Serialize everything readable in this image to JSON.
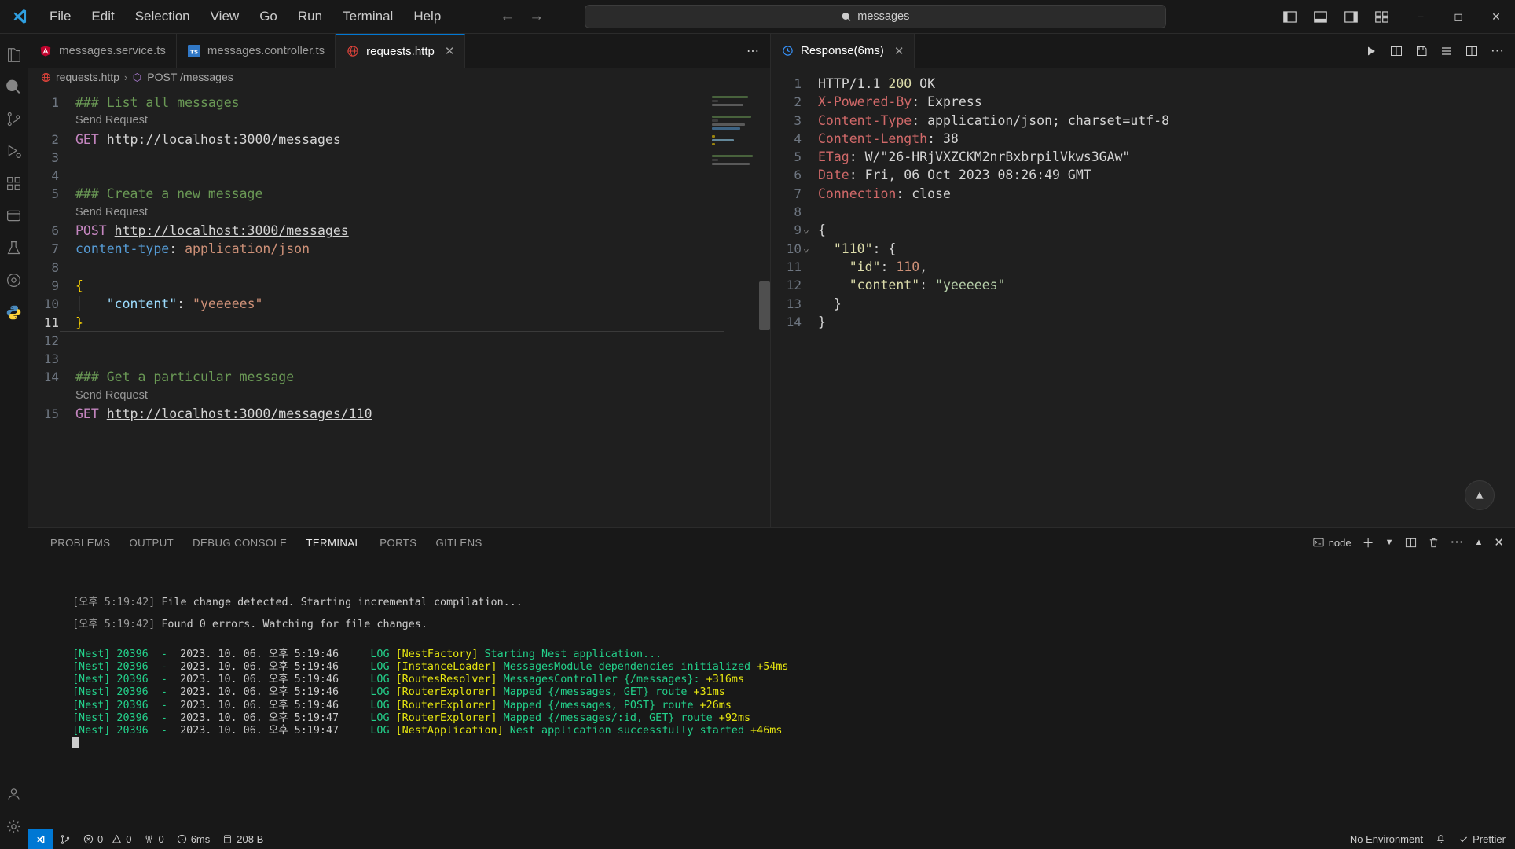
{
  "titlebar": {
    "logo_icon": "vscode-logo-icon",
    "menus": [
      "File",
      "Edit",
      "Selection",
      "View",
      "Go",
      "Run",
      "Terminal",
      "Help"
    ],
    "back_icon": "arrow-left-icon",
    "forward_icon": "arrow-right-icon",
    "command_center": {
      "search_icon": "search-icon",
      "value": "messages"
    },
    "layout_icons": [
      "toggle-primary-sidebar-icon",
      "toggle-panel-icon",
      "toggle-secondary-sidebar-icon",
      "customize-layout-icon"
    ],
    "window_controls": {
      "minimize": "minimize-icon",
      "maximize": "maximize-icon",
      "close": "close-icon"
    }
  },
  "activitybar": {
    "items": [
      {
        "name": "explorer",
        "icon": "files-icon"
      },
      {
        "name": "search",
        "icon": "search-icon"
      },
      {
        "name": "source-control",
        "icon": "source-control-icon"
      },
      {
        "name": "run-and-debug",
        "icon": "run-debug-icon"
      },
      {
        "name": "extensions",
        "icon": "extensions-icon"
      },
      {
        "name": "rest-client",
        "icon": "rest-client-icon"
      },
      {
        "name": "testing",
        "icon": "beaker-icon"
      },
      {
        "name": "gitlens",
        "icon": "gitlens-icon"
      },
      {
        "name": "python",
        "icon": "python-icon"
      }
    ],
    "bottom": [
      {
        "name": "accounts",
        "icon": "account-icon"
      },
      {
        "name": "manage",
        "icon": "gear-icon"
      }
    ]
  },
  "editor_left": {
    "tabs": [
      {
        "label": "messages.service.ts",
        "icon": "angular-file-icon",
        "active": false
      },
      {
        "label": "messages.controller.ts",
        "icon": "typescript-file-icon",
        "active": false
      },
      {
        "label": "requests.http",
        "icon": "http-file-icon",
        "active": true,
        "close_icon": "close-icon"
      }
    ],
    "overflow_icon": "more-actions-icon",
    "breadcrumb": [
      {
        "label": "requests.http",
        "icon": "http-file-icon"
      },
      {
        "label": "POST /messages",
        "icon": "symbol-object-icon"
      }
    ],
    "codelens_label": "Send Request",
    "lines": [
      {
        "n": 1,
        "codelens": false,
        "tokens": [
          {
            "c": "t-cmt",
            "t": "### List all messages"
          }
        ]
      },
      {
        "n": 1,
        "codelens": true
      },
      {
        "n": 2,
        "tokens": [
          {
            "c": "t-verb",
            "t": "GET "
          },
          {
            "c": "t-url",
            "t": "http://localhost:3000/messages"
          }
        ]
      },
      {
        "n": 3,
        "tokens": []
      },
      {
        "n": 4,
        "tokens": []
      },
      {
        "n": 5,
        "tokens": [
          {
            "c": "t-cmt",
            "t": "### Create a new message"
          }
        ]
      },
      {
        "n": 5,
        "codelens": true
      },
      {
        "n": 6,
        "tokens": [
          {
            "c": "t-verb",
            "t": "POST "
          },
          {
            "c": "t-url",
            "t": "http://localhost:3000/messages"
          }
        ]
      },
      {
        "n": 7,
        "tokens": [
          {
            "c": "t-hdr",
            "t": "content-type"
          },
          {
            "c": "t-plain",
            "t": ": "
          },
          {
            "c": "t-hdrval",
            "t": "application/json"
          }
        ]
      },
      {
        "n": 8,
        "tokens": []
      },
      {
        "n": 9,
        "tokens": [
          {
            "c": "t-brace",
            "t": "{"
          }
        ]
      },
      {
        "n": 10,
        "tokens": [
          {
            "c": "indent-guide",
            "t": "│   "
          },
          {
            "c": "t-key",
            "t": "\"content\""
          },
          {
            "c": "t-plain",
            "t": ": "
          },
          {
            "c": "t-str",
            "t": "\"yeeeees\""
          }
        ]
      },
      {
        "n": 11,
        "active": true,
        "tokens": [
          {
            "c": "t-brace",
            "t": "}"
          }
        ]
      },
      {
        "n": 12,
        "tokens": []
      },
      {
        "n": 13,
        "tokens": []
      },
      {
        "n": 14,
        "tokens": [
          {
            "c": "t-cmt",
            "t": "### Get a particular message"
          }
        ]
      },
      {
        "n": 14,
        "codelens": true
      },
      {
        "n": 15,
        "tokens": [
          {
            "c": "t-verb",
            "t": "GET "
          },
          {
            "c": "t-url",
            "t": "http://localhost:3000/messages/110"
          }
        ]
      }
    ]
  },
  "editor_right": {
    "tab": {
      "label": "Response(6ms)",
      "icon": "response-icon",
      "close_icon": "close-icon"
    },
    "actions": [
      "run-icon",
      "split-response-icon",
      "save-response-icon",
      "fold-icon",
      "split-editor-icon",
      "more-actions-icon"
    ],
    "scroll_top_icon": "chevron-up-icon",
    "lines": [
      {
        "n": 1,
        "tokens": [
          {
            "c": "t-plain",
            "t": "HTTP/1.1 "
          },
          {
            "c": "t-status",
            "t": "200"
          },
          {
            "c": "t-plain",
            "t": " OK"
          }
        ]
      },
      {
        "n": 2,
        "tokens": [
          {
            "c": "t-hdrname",
            "t": "X-Powered-By"
          },
          {
            "c": "t-plain",
            "t": ": Express"
          }
        ]
      },
      {
        "n": 3,
        "tokens": [
          {
            "c": "t-hdrname",
            "t": "Content-Type"
          },
          {
            "c": "t-plain",
            "t": ": application/json; charset=utf-8"
          }
        ]
      },
      {
        "n": 4,
        "tokens": [
          {
            "c": "t-hdrname",
            "t": "Content-Length"
          },
          {
            "c": "t-plain",
            "t": ": 38"
          }
        ]
      },
      {
        "n": 5,
        "tokens": [
          {
            "c": "t-hdrname",
            "t": "ETag"
          },
          {
            "c": "t-plain",
            "t": ": W/\"26-HRjVXZCKM2nrBxbrpilVkws3GAw\""
          }
        ]
      },
      {
        "n": 6,
        "tokens": [
          {
            "c": "t-hdrname",
            "t": "Date"
          },
          {
            "c": "t-plain",
            "t": ": Fri, 06 Oct 2023 08:26:49 GMT"
          }
        ]
      },
      {
        "n": 7,
        "tokens": [
          {
            "c": "t-hdrname",
            "t": "Connection"
          },
          {
            "c": "t-plain",
            "t": ": close"
          }
        ]
      },
      {
        "n": 8,
        "tokens": []
      },
      {
        "n": 9,
        "fold": "open",
        "tokens": [
          {
            "c": "t-plain",
            "t": "{"
          }
        ]
      },
      {
        "n": 10,
        "fold": "open",
        "tokens": [
          {
            "c": "t-plain",
            "t": "  "
          },
          {
            "c": "t-respk",
            "t": "\"110\""
          },
          {
            "c": "t-plain",
            "t": ": {"
          }
        ]
      },
      {
        "n": 11,
        "tokens": [
          {
            "c": "t-plain",
            "t": "    "
          },
          {
            "c": "t-respk",
            "t": "\"id\""
          },
          {
            "c": "t-plain",
            "t": ": "
          },
          {
            "c": "t-respn",
            "t": "110"
          },
          {
            "c": "t-plain",
            "t": ","
          }
        ]
      },
      {
        "n": 12,
        "tokens": [
          {
            "c": "t-plain",
            "t": "    "
          },
          {
            "c": "t-respk",
            "t": "\"content\""
          },
          {
            "c": "t-plain",
            "t": ": "
          },
          {
            "c": "t-resps",
            "t": "\"yeeeees\""
          }
        ]
      },
      {
        "n": 13,
        "tokens": [
          {
            "c": "t-plain",
            "t": "  }"
          }
        ]
      },
      {
        "n": 14,
        "tokens": [
          {
            "c": "t-plain",
            "t": "}"
          }
        ]
      }
    ]
  },
  "panel": {
    "tabs": [
      {
        "label": "PROBLEMS",
        "active": false
      },
      {
        "label": "OUTPUT",
        "active": false
      },
      {
        "label": "DEBUG CONSOLE",
        "active": false
      },
      {
        "label": "TERMINAL",
        "active": true
      },
      {
        "label": "PORTS",
        "active": false
      },
      {
        "label": "GITLENS",
        "active": false
      }
    ],
    "actions": {
      "terminal_name": "node",
      "terminal_icon": "terminal-split-icon",
      "new_terminal_icon": "plus-icon",
      "dropdown_icon": "chevron-down-icon",
      "split_icon": "split-terminal-icon",
      "kill_icon": "trash-icon",
      "more_icon": "more-actions-icon",
      "maximize_icon": "chevron-up-icon",
      "close_icon": "close-icon"
    },
    "terminal_lines": [
      {
        "type": "gap"
      },
      {
        "type": "tsc",
        "segs": [
          {
            "c": "c-gray",
            "t": "[오후 5:19:42] "
          },
          {
            "c": "c-white",
            "t": "File change detected. Starting incremental compilation..."
          }
        ]
      },
      {
        "type": "gap"
      },
      {
        "type": "tsc",
        "segs": [
          {
            "c": "c-gray",
            "t": "[오후 5:19:42] "
          },
          {
            "c": "c-white",
            "t": "Found 0 errors. Watching for file changes."
          }
        ]
      },
      {
        "type": "gap"
      },
      {
        "type": "gap"
      },
      {
        "type": "nest",
        "segs": [
          {
            "c": "c-green",
            "t": "[Nest] 20396  -  "
          },
          {
            "c": "c-white",
            "t": "2023. 10. 06. 오후 5:19:46     "
          },
          {
            "c": "c-green",
            "t": "LOG "
          },
          {
            "c": "c-yellow",
            "t": "[NestFactory] "
          },
          {
            "c": "c-green",
            "t": "Starting Nest application..."
          }
        ]
      },
      {
        "type": "nest",
        "segs": [
          {
            "c": "c-green",
            "t": "[Nest] 20396  -  "
          },
          {
            "c": "c-white",
            "t": "2023. 10. 06. 오후 5:19:46     "
          },
          {
            "c": "c-green",
            "t": "LOG "
          },
          {
            "c": "c-yellow",
            "t": "[InstanceLoader] "
          },
          {
            "c": "c-green",
            "t": "MessagesModule dependencies initialized "
          },
          {
            "c": "c-yellow",
            "t": "+54ms"
          }
        ]
      },
      {
        "type": "nest",
        "segs": [
          {
            "c": "c-green",
            "t": "[Nest] 20396  -  "
          },
          {
            "c": "c-white",
            "t": "2023. 10. 06. 오후 5:19:46     "
          },
          {
            "c": "c-green",
            "t": "LOG "
          },
          {
            "c": "c-yellow",
            "t": "[RoutesResolver] "
          },
          {
            "c": "c-green",
            "t": "MessagesController {/messages}: "
          },
          {
            "c": "c-yellow",
            "t": "+316ms"
          }
        ]
      },
      {
        "type": "nest",
        "segs": [
          {
            "c": "c-green",
            "t": "[Nest] 20396  -  "
          },
          {
            "c": "c-white",
            "t": "2023. 10. 06. 오후 5:19:46     "
          },
          {
            "c": "c-green",
            "t": "LOG "
          },
          {
            "c": "c-yellow",
            "t": "[RouterExplorer] "
          },
          {
            "c": "c-green",
            "t": "Mapped {/messages, GET} route "
          },
          {
            "c": "c-yellow",
            "t": "+31ms"
          }
        ]
      },
      {
        "type": "nest",
        "segs": [
          {
            "c": "c-green",
            "t": "[Nest] 20396  -  "
          },
          {
            "c": "c-white",
            "t": "2023. 10. 06. 오후 5:19:46     "
          },
          {
            "c": "c-green",
            "t": "LOG "
          },
          {
            "c": "c-yellow",
            "t": "[RouterExplorer] "
          },
          {
            "c": "c-green",
            "t": "Mapped {/messages, POST} route "
          },
          {
            "c": "c-yellow",
            "t": "+26ms"
          }
        ]
      },
      {
        "type": "nest",
        "segs": [
          {
            "c": "c-green",
            "t": "[Nest] 20396  -  "
          },
          {
            "c": "c-white",
            "t": "2023. 10. 06. 오후 5:19:47     "
          },
          {
            "c": "c-green",
            "t": "LOG "
          },
          {
            "c": "c-yellow",
            "t": "[RouterExplorer] "
          },
          {
            "c": "c-green",
            "t": "Mapped {/messages/:id, GET} route "
          },
          {
            "c": "c-yellow",
            "t": "+92ms"
          }
        ]
      },
      {
        "type": "nest",
        "segs": [
          {
            "c": "c-green",
            "t": "[Nest] 20396  -  "
          },
          {
            "c": "c-white",
            "t": "2023. 10. 06. 오후 5:19:47     "
          },
          {
            "c": "c-green",
            "t": "LOG "
          },
          {
            "c": "c-yellow",
            "t": "[NestApplication] "
          },
          {
            "c": "c-green",
            "t": "Nest application successfully started "
          },
          {
            "c": "c-yellow",
            "t": "+46ms"
          }
        ]
      },
      {
        "type": "cursor"
      }
    ]
  },
  "statusbar": {
    "remote_icon": "remote-window-icon",
    "branch_icon": "source-control-icon",
    "items": [
      {
        "name": "errors",
        "icon": "error-icon",
        "value": "0"
      },
      {
        "name": "warnings",
        "icon": "warning-icon",
        "value": "0"
      },
      {
        "name": "radio-tower",
        "icon": "radio-tower-icon",
        "value": "0"
      },
      {
        "name": "response-time",
        "icon": "clock-icon",
        "value": "6ms"
      },
      {
        "name": "response-size",
        "icon": "database-icon",
        "value": "208 B"
      }
    ],
    "right": [
      {
        "name": "environment",
        "label": "No Environment"
      },
      {
        "name": "bell",
        "icon": "bell-icon",
        "label": ""
      },
      {
        "name": "prettier",
        "icon": "check-icon",
        "label": "Prettier"
      }
    ]
  },
  "colors": {
    "accent": "#0078d4",
    "bg": "#1f1f1f",
    "panel_bg": "#181818"
  }
}
